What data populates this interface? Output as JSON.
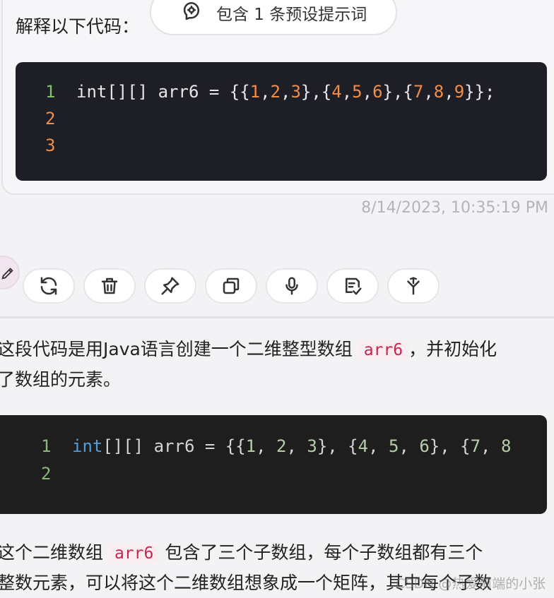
{
  "user_message": {
    "prompt_label": "解释以下代码：",
    "preset_pill_text": "包含 1 条预设提示词",
    "code": {
      "line_numbers": [
        "1",
        "2",
        "3"
      ],
      "line1_prefix": "int[][] arr6 = {{",
      "line1_tokens": [
        {
          "t": "1",
          "num": true
        },
        {
          "t": ",",
          "num": false
        },
        {
          "t": "2",
          "num": true
        },
        {
          "t": ",",
          "num": false
        },
        {
          "t": "3",
          "num": true
        },
        {
          "t": "},{",
          "num": false
        },
        {
          "t": "4",
          "num": true
        },
        {
          "t": ",",
          "num": false
        },
        {
          "t": "5",
          "num": true
        },
        {
          "t": ",",
          "num": false
        },
        {
          "t": "6",
          "num": true
        },
        {
          "t": "},{",
          "num": false
        },
        {
          "t": "7",
          "num": true
        },
        {
          "t": ",",
          "num": false
        },
        {
          "t": "8",
          "num": true
        },
        {
          "t": ",",
          "num": false
        },
        {
          "t": "9",
          "num": true
        },
        {
          "t": "}};",
          "num": false
        }
      ]
    },
    "timestamp": "8/14/2023, 10:35:19 PM"
  },
  "actions": [
    {
      "name": "regenerate-button",
      "icon": "refresh-icon"
    },
    {
      "name": "delete-button",
      "icon": "trash-icon"
    },
    {
      "name": "pin-button",
      "icon": "pin-icon"
    },
    {
      "name": "copy-button",
      "icon": "copy-icon"
    },
    {
      "name": "speak-button",
      "icon": "microphone-icon"
    },
    {
      "name": "select-button",
      "icon": "checklist-icon"
    },
    {
      "name": "fork-button",
      "icon": "fork-icon"
    }
  ],
  "answer": {
    "p1_line1_before": "这段代码是用Java语言创建一个二维整型数组",
    "p1_code": "arr6",
    "p1_line1_after": "，并初始化",
    "p1_line2": "了数组的元素。",
    "code": {
      "line_numbers": [
        "1",
        "2"
      ],
      "keyword": "int",
      "rest": "[][] arr6 = {{",
      "tokens": [
        {
          "t": "1",
          "num": true
        },
        {
          "t": ", ",
          "num": false
        },
        {
          "t": "2",
          "num": true
        },
        {
          "t": ", ",
          "num": false
        },
        {
          "t": "3",
          "num": true
        },
        {
          "t": "}, {",
          "num": false
        },
        {
          "t": "4",
          "num": true
        },
        {
          "t": ", ",
          "num": false
        },
        {
          "t": "5",
          "num": true
        },
        {
          "t": ", ",
          "num": false
        },
        {
          "t": "6",
          "num": true
        },
        {
          "t": "}, {",
          "num": false
        },
        {
          "t": "7",
          "num": true
        },
        {
          "t": ", ",
          "num": false
        },
        {
          "t": "8",
          "num": true
        }
      ]
    },
    "p2_line1_before": "这个二维数组",
    "p2_code": "arr6",
    "p2_line1_after": "包含了三个子数组，每个子数组都有三个",
    "p2_line2": "整数元素，可以将这个二维数组想象成一个矩阵，其中每个子数"
  },
  "watermark": "CSDN @热爱前端的小张"
}
